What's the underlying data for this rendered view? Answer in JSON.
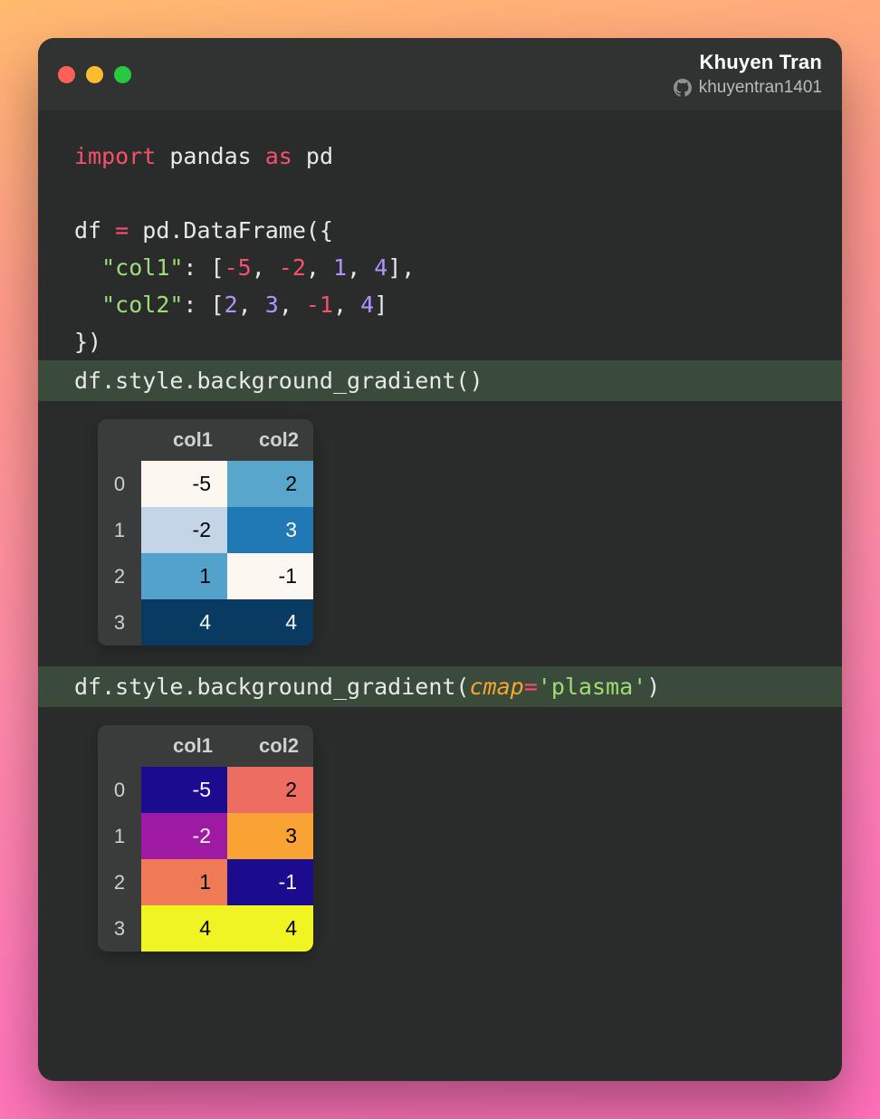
{
  "credits": {
    "author": "Khuyen Tran",
    "handle": "khuyentran1401"
  },
  "code": {
    "l1_import": "import",
    "l1_pandas": " pandas ",
    "l1_as": "as",
    "l1_pd": " pd",
    "l3_a": "df ",
    "l3_eq": "=",
    "l3_b": " pd.DataFrame({",
    "l4_pad": "  ",
    "l4_key": "\"col1\"",
    "l4_col": ": [",
    "l4_n1": "-5",
    "l4_c1": ", ",
    "l4_n2": "-2",
    "l4_c2": ", ",
    "l4_n3": "1",
    "l4_c3": ", ",
    "l4_n4": "4",
    "l4_close": "],",
    "l5_pad": "  ",
    "l5_key": "\"col2\"",
    "l5_col": ": [",
    "l5_n1": "2",
    "l5_c1": ", ",
    "l5_n2": "3",
    "l5_c2": ", ",
    "l5_n3": "-1",
    "l5_c3": ", ",
    "l5_n4": "4",
    "l5_close": "]",
    "l6": "})",
    "callA": "df.style.background_gradient()",
    "callB_a": "df.style.background_gradient(",
    "callB_kw": "cmap",
    "callB_eq": "=",
    "callB_val": "'plasma'",
    "callB_close": ")"
  },
  "table1": {
    "headers": [
      "col1",
      "col2"
    ],
    "rows": [
      {
        "idx": "0",
        "cells": [
          {
            "v": "-5",
            "bg": "#fdf7f2",
            "txt": "dark"
          },
          {
            "v": "2",
            "bg": "#59a6cc",
            "txt": "dark"
          }
        ]
      },
      {
        "idx": "1",
        "cells": [
          {
            "v": "-2",
            "bg": "#c4d5e8",
            "txt": "dark"
          },
          {
            "v": "3",
            "bg": "#2078b4",
            "txt": "light"
          }
        ]
      },
      {
        "idx": "2",
        "cells": [
          {
            "v": "1",
            "bg": "#53a2cb",
            "txt": "dark"
          },
          {
            "v": "-1",
            "bg": "#fdf7f2",
            "txt": "dark"
          }
        ]
      },
      {
        "idx": "3",
        "cells": [
          {
            "v": "4",
            "bg": "#083a62",
            "txt": "light"
          },
          {
            "v": "4",
            "bg": "#083a62",
            "txt": "light"
          }
        ]
      }
    ]
  },
  "table2": {
    "headers": [
      "col1",
      "col2"
    ],
    "rows": [
      {
        "idx": "0",
        "cells": [
          {
            "v": "-5",
            "bg": "#1a0b8f",
            "txt": "light"
          },
          {
            "v": "2",
            "bg": "#ee6d63",
            "txt": "dark"
          }
        ]
      },
      {
        "idx": "1",
        "cells": [
          {
            "v": "-2",
            "bg": "#9e1aa2",
            "txt": "light"
          },
          {
            "v": "3",
            "bg": "#f8a333",
            "txt": "dark"
          }
        ]
      },
      {
        "idx": "2",
        "cells": [
          {
            "v": "1",
            "bg": "#ee7b55",
            "txt": "dark"
          },
          {
            "v": "-1",
            "bg": "#1a0b8f",
            "txt": "light"
          }
        ]
      },
      {
        "idx": "3",
        "cells": [
          {
            "v": "4",
            "bg": "#f1f423",
            "txt": "dark"
          },
          {
            "v": "4",
            "bg": "#f1f423",
            "txt": "dark"
          }
        ]
      }
    ]
  }
}
